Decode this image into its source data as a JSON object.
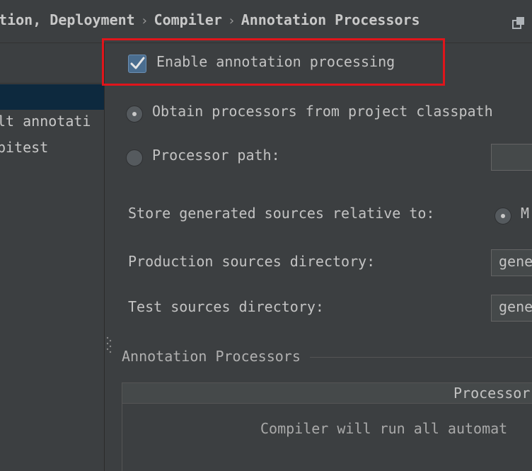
{
  "header": {
    "crumbs": [
      "ution, Deployment",
      "Compiler",
      "Annotation Processors"
    ],
    "separator": "›"
  },
  "tree": {
    "items": [
      "lt annotati",
      "pitest"
    ]
  },
  "settings": {
    "enable_label": "Enable annotation processing",
    "enable_checked": true,
    "obtain_label": "Obtain processors from project classpath",
    "processor_path_label": "Processor path:",
    "store_label": "Store generated sources relative to:",
    "store_option_partial": "M",
    "production_label": "Production sources directory:",
    "production_value": "gene",
    "test_label": "Test sources directory:",
    "test_value": "gene",
    "section_title": "Annotation Processors",
    "table_header": "Processor",
    "table_empty": "Compiler will run all automat"
  },
  "colors": {
    "highlight": "#e0151b",
    "selection": "#0d293e",
    "accent": "#4a6d8f"
  },
  "icons": {
    "copy": "copy-icon",
    "check": "check-icon",
    "grip": "drag-handle-icon"
  }
}
